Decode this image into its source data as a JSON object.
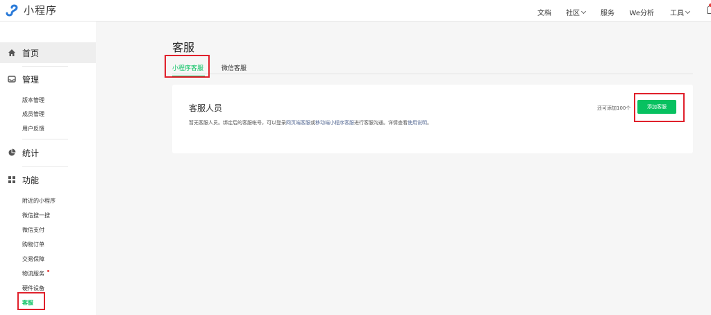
{
  "brand": {
    "name": "小程序",
    "logo_icon": "miniprogram-logo-icon",
    "logo_color": "#1aad19"
  },
  "topnav": {
    "docs": "文档",
    "community": "社区",
    "service": "服务",
    "analytics": "We分析",
    "tools": "工具",
    "bell_icon": "bell-icon"
  },
  "sidebar": {
    "home": "首页",
    "manage": {
      "label": "管理",
      "items": [
        "版本管理",
        "成员管理",
        "用户反馈"
      ]
    },
    "stats": "统计",
    "features": {
      "label": "功能",
      "items": [
        "附近的小程序",
        "微信搜一搜",
        "微信支付",
        "购物订单",
        "交易保障",
        "物流服务",
        "硬件设备",
        "客服"
      ]
    }
  },
  "main": {
    "title": "客服",
    "tabs": [
      "小程序客服",
      "微信客服"
    ],
    "card": {
      "title": "客服人员",
      "desc_prefix": "暂无客服人员。绑定后的客服帐号，可以登录",
      "link_web": "网页端客服",
      "desc_or": "或",
      "link_mobile": "移动端小程序客服",
      "desc_suffix": "进行客服沟通。详情查看",
      "link_usage": "使用说明",
      "desc_end": "。",
      "quota": "还可添加100个",
      "add_button": "添加客服"
    }
  },
  "colors": {
    "accent": "#07c160",
    "highlight": "#e0202b",
    "link": "#576b95"
  }
}
